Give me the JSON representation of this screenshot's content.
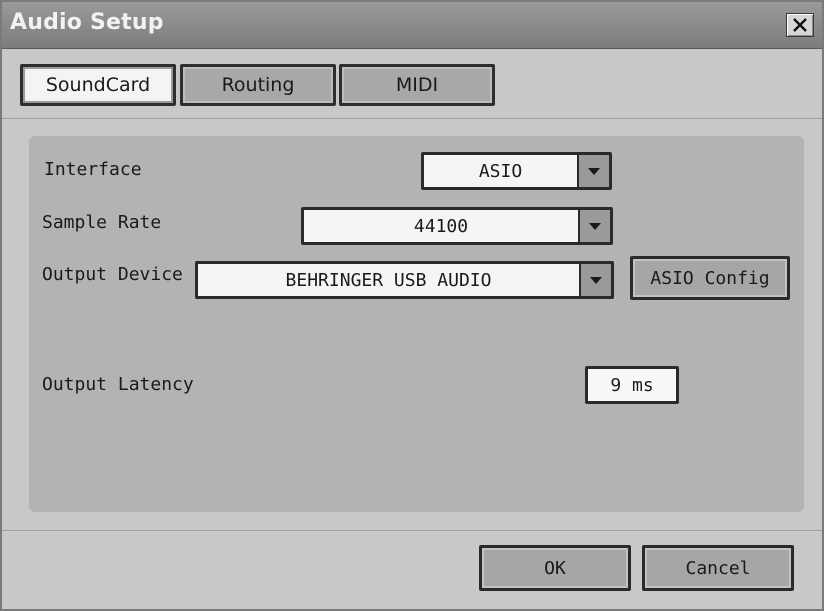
{
  "window": {
    "title": "Audio Setup",
    "close_icon": "close-icon"
  },
  "tabs": [
    {
      "label": "SoundCard",
      "active": true
    },
    {
      "label": "Routing",
      "active": false
    },
    {
      "label": "MIDI",
      "active": false
    }
  ],
  "soundcard": {
    "interface": {
      "label": "Interface",
      "value": "ASIO"
    },
    "sample_rate": {
      "label": "Sample Rate",
      "value": "44100"
    },
    "output_device": {
      "label": "Output Device",
      "value": "BEHRINGER USB AUDIO"
    },
    "asio_config_label": "ASIO Config",
    "output_latency": {
      "label": "Output Latency",
      "value": "9 ms"
    }
  },
  "footer": {
    "ok_label": "OK",
    "cancel_label": "Cancel"
  },
  "icons": {
    "dropdown_arrow": "chevron-down-icon"
  }
}
